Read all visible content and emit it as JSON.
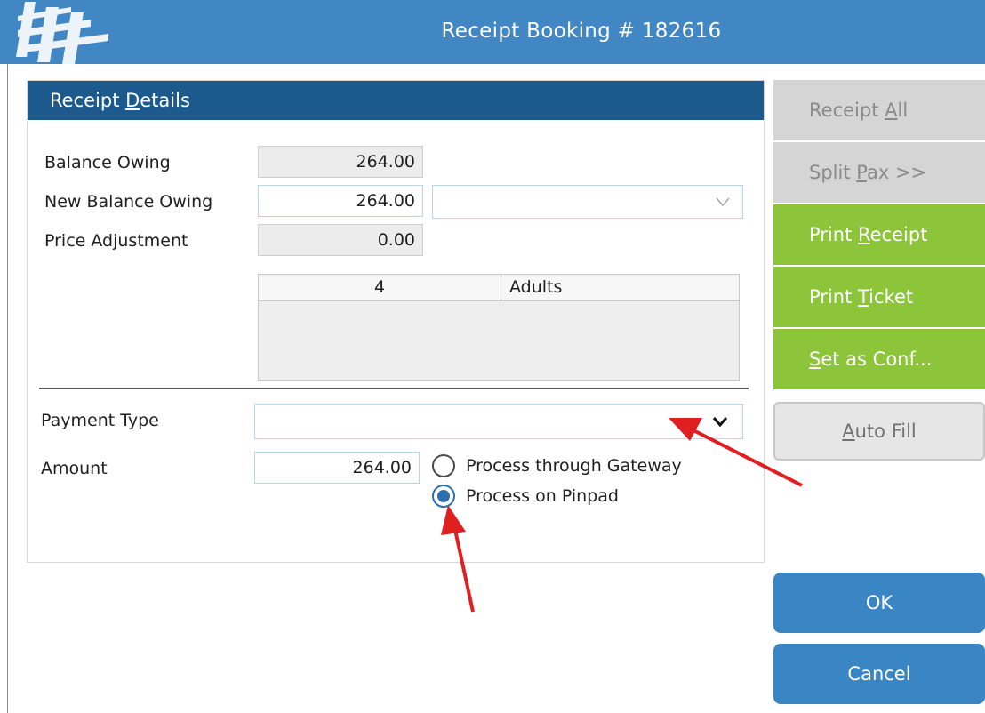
{
  "window": {
    "title": "Receipt Booking # 182616"
  },
  "panel": {
    "header_pre": "Receipt ",
    "header_u": "D",
    "header_post": "etails",
    "balance_owing_label": "Balance Owing",
    "balance_owing_value": "264.00",
    "new_balance_owing_label": "New Balance Owing",
    "new_balance_owing_value": "264.00",
    "price_adjustment_label": "Price Adjustment",
    "price_adjustment_value": "0.00",
    "pax_table": {
      "count": "4",
      "type": "Adults"
    },
    "payment_type_label": "Payment Type",
    "payment_type_value": "",
    "amount_label": "Amount",
    "amount_value": "264.00",
    "radio_gateway_label": "Process through Gateway",
    "radio_pinpad_label": "Process on Pinpad",
    "selected_option": "Process on Pinpad"
  },
  "buttons": {
    "receipt_all_pre": "Receipt ",
    "receipt_all_u": "A",
    "receipt_all_post": "ll",
    "split_pax_pre": "Split ",
    "split_pax_u": "P",
    "split_pax_post": "ax >>",
    "print_receipt_pre": "Print ",
    "print_receipt_u": "R",
    "print_receipt_post": "eceipt",
    "print_ticket_pre": "Print ",
    "print_ticket_u": "T",
    "print_ticket_post": "icket",
    "set_conf_u": "S",
    "set_conf_post": "et as Conf...",
    "auto_fill_u": "A",
    "auto_fill_post": "uto Fill",
    "ok": "OK",
    "cancel": "Cancel"
  },
  "colors": {
    "titlebar": "#4187c4",
    "panel_header": "#1c5a8e",
    "green_button": "#8cc43a",
    "blue_button": "#3a86c4",
    "annotation_arrow": "#e02020"
  }
}
